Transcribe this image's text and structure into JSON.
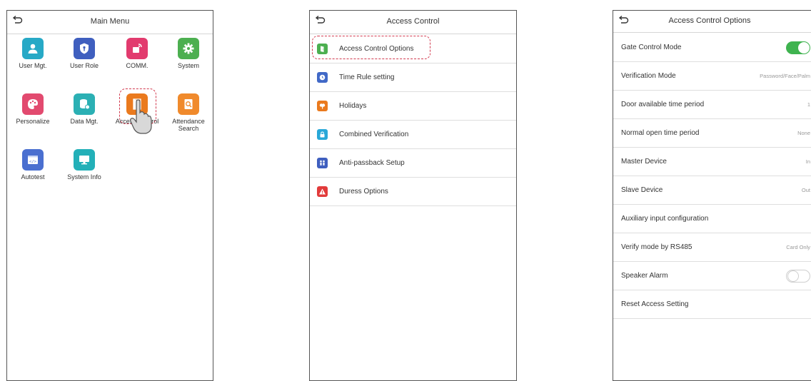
{
  "screen1": {
    "title": "Main Menu",
    "tiles": [
      {
        "label": "User Mgt.",
        "color": "#27a9c6",
        "icon": "user-icon"
      },
      {
        "label": "User Role",
        "color": "#3f5fbf",
        "icon": "shield-icon"
      },
      {
        "label": "COMM.",
        "color": "#e23b6e",
        "icon": "comm-icon"
      },
      {
        "label": "System",
        "color": "#4caf50",
        "icon": "gear-icon"
      },
      {
        "label": "Personalize",
        "color": "#e24a6f",
        "icon": "palette-icon"
      },
      {
        "label": "Data Mgt.",
        "color": "#2bb0b4",
        "icon": "database-icon"
      },
      {
        "label": "Access Control",
        "color": "#ea7a1e",
        "icon": "door-icon"
      },
      {
        "label": "Attendance\nSearch",
        "color": "#f08a2c",
        "icon": "search-doc-icon"
      },
      {
        "label": "Autotest",
        "color": "#4a6fd0",
        "icon": "code-icon"
      },
      {
        "label": "System Info",
        "color": "#23b0b8",
        "icon": "monitor-icon"
      }
    ]
  },
  "screen2": {
    "title": "Access Control",
    "items": [
      {
        "label": "Access Control Options",
        "color": "#4caf50",
        "icon": "door-icon"
      },
      {
        "label": "Time Rule setting",
        "color": "#4169c7",
        "icon": "clock-icon"
      },
      {
        "label": "Holidays",
        "color": "#ea7a1e",
        "icon": "holiday-icon"
      },
      {
        "label": "Combined Verification",
        "color": "#29a8d8",
        "icon": "lock-icon"
      },
      {
        "label": "Anti-passback Setup",
        "color": "#3f5fbf",
        "icon": "people-icon"
      },
      {
        "label": "Duress Options",
        "color": "#e23b3b",
        "icon": "warning-icon"
      }
    ]
  },
  "screen3": {
    "title": "Access Control Options",
    "items": [
      {
        "label": "Gate Control Mode",
        "toggle": "on"
      },
      {
        "label": "Verification Mode",
        "value": "Password/Face/Palm"
      },
      {
        "label": "Door available time period",
        "value": "1"
      },
      {
        "label": "Normal open time period",
        "value": "None"
      },
      {
        "label": "Master Device",
        "value": "In"
      },
      {
        "label": "Slave Device",
        "value": "Out"
      },
      {
        "label": "Auxiliary input configuration",
        "value": ""
      },
      {
        "label": "Verify mode by RS485",
        "value": "Card Only"
      },
      {
        "label": "Speaker Alarm",
        "toggle": "off"
      },
      {
        "label": "Reset Access Setting",
        "value": ""
      }
    ]
  }
}
